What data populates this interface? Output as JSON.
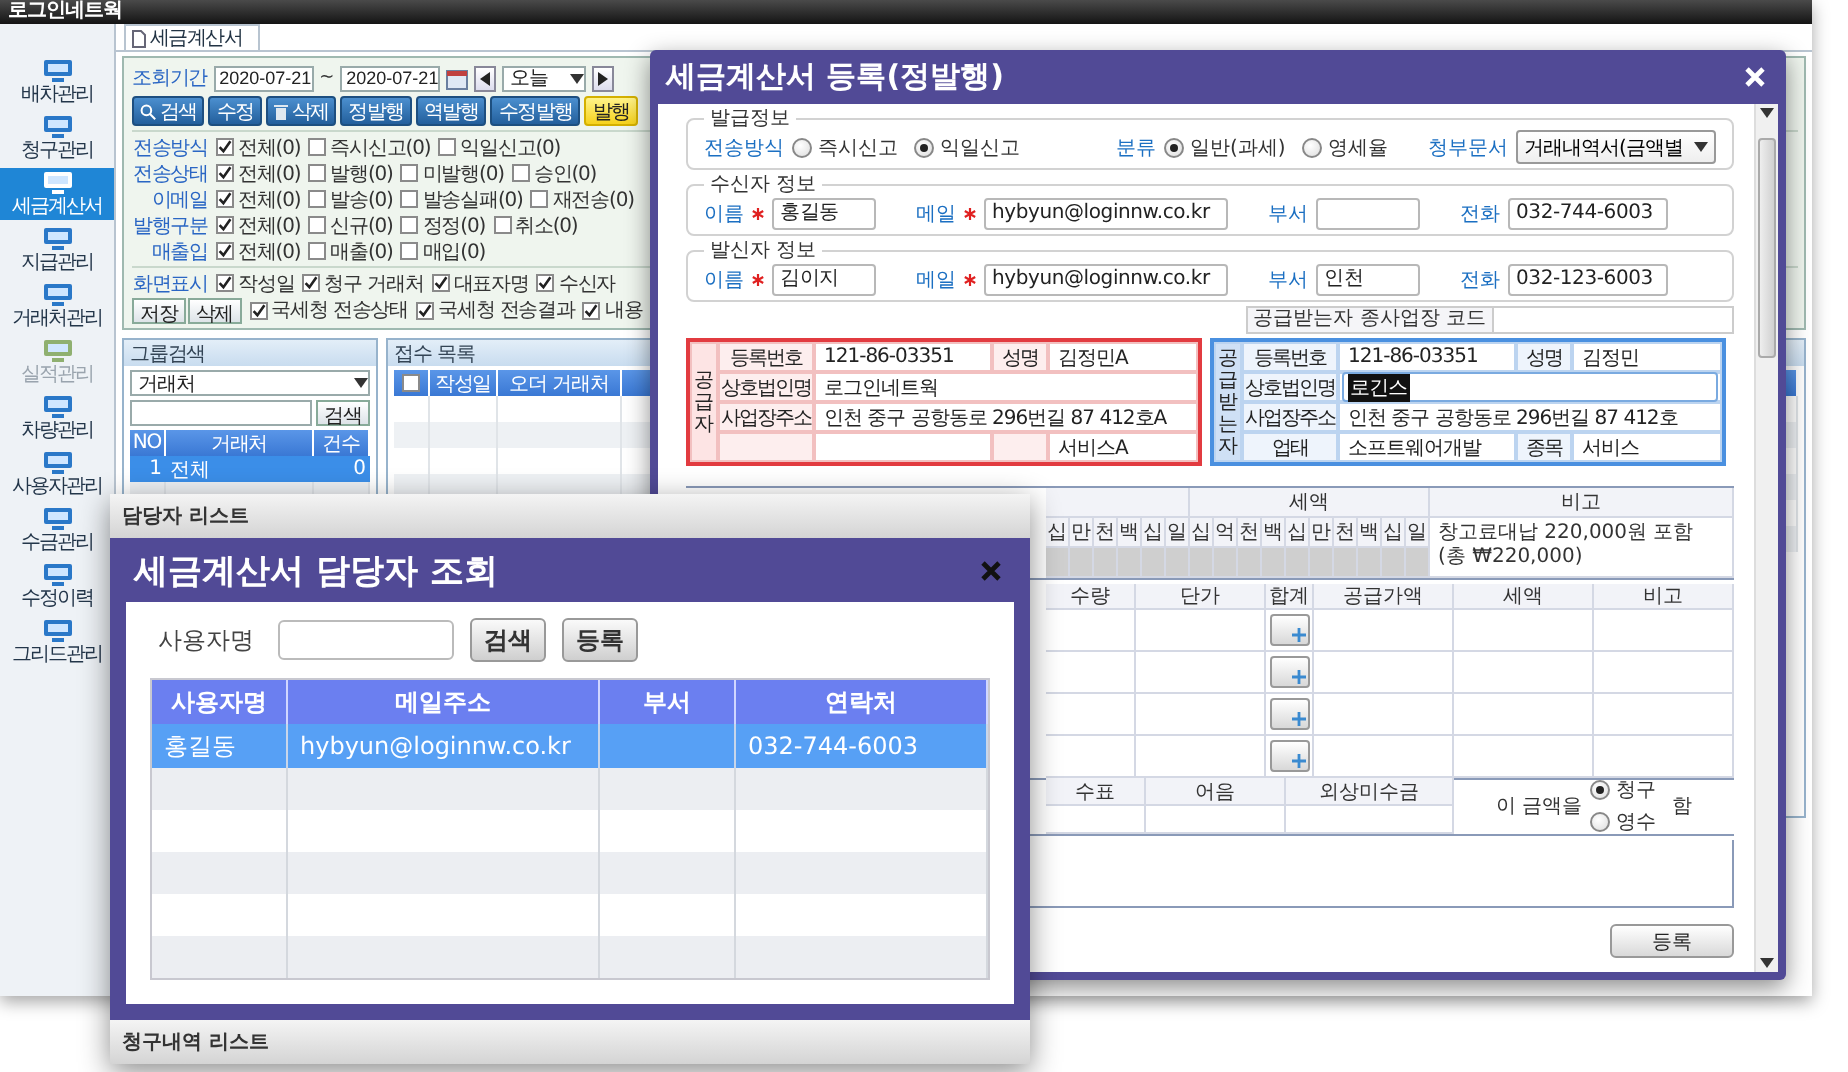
{
  "app": {
    "title": "로그인네트웍",
    "sidebar": [
      {
        "label": "배차관리",
        "selected": false,
        "disabled": false
      },
      {
        "label": "청구관리",
        "selected": false,
        "disabled": false
      },
      {
        "label": "세금계산서",
        "selected": true,
        "disabled": false
      },
      {
        "label": "지급관리",
        "selected": false,
        "disabled": false
      },
      {
        "label": "거래처관리",
        "selected": false,
        "disabled": false
      },
      {
        "label": "실적관리",
        "selected": false,
        "disabled": true
      },
      {
        "label": "차량관리",
        "selected": false,
        "disabled": false
      },
      {
        "label": "사용자관리",
        "selected": false,
        "disabled": false
      },
      {
        "label": "수금관리",
        "selected": false,
        "disabled": false
      },
      {
        "label": "수정이력",
        "selected": false,
        "disabled": false
      },
      {
        "label": "그리드관리",
        "selected": false,
        "disabled": false
      }
    ],
    "tab": "세금계산서",
    "period": {
      "label": "조회기간",
      "from": "2020-07-21",
      "separator": "~",
      "to": "2020-07-21",
      "preset": "오늘"
    },
    "buttons": [
      {
        "label": "검색",
        "kind": "search"
      },
      {
        "label": "수정",
        "kind": "plain"
      },
      {
        "label": "삭제",
        "kind": "delete"
      },
      {
        "label": "정발행",
        "kind": "plain"
      },
      {
        "label": "역발행",
        "kind": "plain"
      },
      {
        "label": "수정발행",
        "kind": "plain"
      },
      {
        "label": "발행",
        "kind": "highlight"
      }
    ],
    "filters": [
      {
        "label": "전송방식",
        "options": [
          {
            "label": "전체(0)",
            "checked": true
          },
          {
            "label": "즉시신고(0)",
            "checked": false
          },
          {
            "label": "익일신고(0)",
            "checked": false
          }
        ]
      },
      {
        "label": "전송상태",
        "options": [
          {
            "label": "전체(0)",
            "checked": true
          },
          {
            "label": "발행(0)",
            "checked": false
          },
          {
            "label": "미발행(0)",
            "checked": false
          },
          {
            "label": "승인(0)",
            "checked": false
          }
        ]
      },
      {
        "label": "이메일",
        "options": [
          {
            "label": "전체(0)",
            "checked": true
          },
          {
            "label": "발송(0)",
            "checked": false
          },
          {
            "label": "발송실패(0)",
            "checked": false
          },
          {
            "label": "재전송(0)",
            "checked": false
          }
        ]
      },
      {
        "label": "발행구분",
        "options": [
          {
            "label": "전체(0)",
            "checked": true
          },
          {
            "label": "신규(0)",
            "checked": false
          },
          {
            "label": "정정(0)",
            "checked": false
          },
          {
            "label": "취소(0)",
            "checked": false
          }
        ]
      },
      {
        "label": "매출입",
        "options": [
          {
            "label": "전체(0)",
            "checked": true
          },
          {
            "label": "매출(0)",
            "checked": false
          },
          {
            "label": "매입(0)",
            "checked": false
          }
        ]
      }
    ],
    "display": {
      "label": "화면표시",
      "options": [
        {
          "label": "작성일",
          "checked": true
        },
        {
          "label": "청구 거래처",
          "checked": true
        },
        {
          "label": "대표자명",
          "checked": true
        },
        {
          "label": "수신자",
          "checked": true
        }
      ],
      "actions": [
        "저장",
        "삭제"
      ],
      "more_options": [
        {
          "label": "국세청 전송상태",
          "checked": true
        },
        {
          "label": "국세청 전송결과",
          "checked": true
        },
        {
          "label": "내용",
          "checked": true
        }
      ]
    },
    "group_panel": {
      "title": "그룹검색",
      "select": "거래처",
      "search_button": "검색",
      "columns": [
        "NO",
        "거래처",
        "건수"
      ],
      "rows": [
        {
          "no": "1",
          "name": "전체",
          "count": "0",
          "selected": true
        }
      ]
    },
    "list_panel": {
      "title": "접수 목록",
      "select_all": false,
      "columns": [
        "작성일",
        "오더 거래처"
      ]
    }
  },
  "tax_dialog": {
    "title": "세금계산서 등록(정발행)",
    "issue": {
      "legend": "발급정보",
      "groups": [
        {
          "label": "전송방식",
          "options": [
            {
              "label": "즉시신고",
              "selected": false
            },
            {
              "label": "익일신고",
              "selected": true
            }
          ]
        },
        {
          "label": "분류",
          "options": [
            {
              "label": "일반(과세)",
              "selected": true
            },
            {
              "label": "영세율",
              "selected": false
            }
          ]
        }
      ],
      "attachment_label": "청부문서",
      "attachment": "거래내역서(금액별"
    },
    "receiver": {
      "legend": "수신자 정보",
      "fields": [
        {
          "label": "이름",
          "required": true,
          "value": "홍길동"
        },
        {
          "label": "메일",
          "required": true,
          "value": "hybyun@loginnw.co.kr"
        },
        {
          "label": "부서",
          "required": false
        },
        {
          "label": "전화",
          "required": false,
          "value": "032-744-6003"
        }
      ]
    },
    "sender": {
      "legend": "발신자 정보",
      "fields": [
        {
          "label": "이름",
          "required": true,
          "value": "김이지"
        },
        {
          "label": "메일",
          "required": true,
          "value": "hybyun@loginnw.co.kr"
        },
        {
          "label": "부서",
          "required": false,
          "value": "인천"
        },
        {
          "label": "전화",
          "required": false,
          "value": "032-123-6003"
        }
      ]
    },
    "sub_code_label": "공급받는자 종사업장 코드",
    "supplier": {
      "side": "공급자",
      "reg_label": "등록번호",
      "reg": "121-86-03351",
      "name_label": "성명",
      "name": "김정민A",
      "company_label": "상호법인명",
      "company": "로그인네트웍",
      "address_label": "사업장주소",
      "address": "인천 중구 공항동로 296번길 87 412호A",
      "item": "서비스A"
    },
    "buyer": {
      "side": "공급받는자",
      "reg_label": "등록번호",
      "reg": "121-86-03351",
      "name_label": "성명",
      "name": "김정민",
      "company_label": "상호법인명",
      "company": "로긴스",
      "address_label": "사업장주소",
      "address": "인천 중구 공항동로 296번길 87 412호",
      "business_label": "업태",
      "business": "소프트웨어개발",
      "item_label": "종목",
      "item": "서비스"
    },
    "amounts": {
      "tax_header": "세액",
      "note_header": "비고",
      "supply_digits": [
        "십",
        "만",
        "천",
        "백",
        "십",
        "일"
      ],
      "tax_digits": [
        "십",
        "억",
        "천",
        "백",
        "십",
        "만",
        "천",
        "백",
        "십",
        "일"
      ],
      "note": "창고료대납 220,000원 포함",
      "note_2": "(총 ₩220,000)"
    },
    "items": {
      "columns": [
        "수량",
        "단가",
        "합계",
        "공급가액",
        "세액",
        "비고"
      ]
    },
    "payment": {
      "columns": [
        "수표",
        "어음",
        "외상미수금"
      ],
      "prefix": "이 금액을",
      "options": [
        {
          "label": "청구",
          "selected": true
        },
        {
          "label": "영수",
          "selected": false
        }
      ],
      "suffix": "함"
    },
    "submit": "등록"
  },
  "contact_dialog": {
    "header": "담당자 리스트",
    "title": "세금계산서 담당자 조회",
    "search_label": "사용자명",
    "buttons": [
      "검색",
      "등록"
    ],
    "columns": [
      "사용자명",
      "메일주소",
      "부서",
      "연락처"
    ],
    "rows": [
      {
        "name": "홍길동",
        "email": "hybyun@loginnw.co.kr",
        "phone": "032-744-6003",
        "selected": true
      }
    ],
    "footer": "청구내역 리스트"
  }
}
